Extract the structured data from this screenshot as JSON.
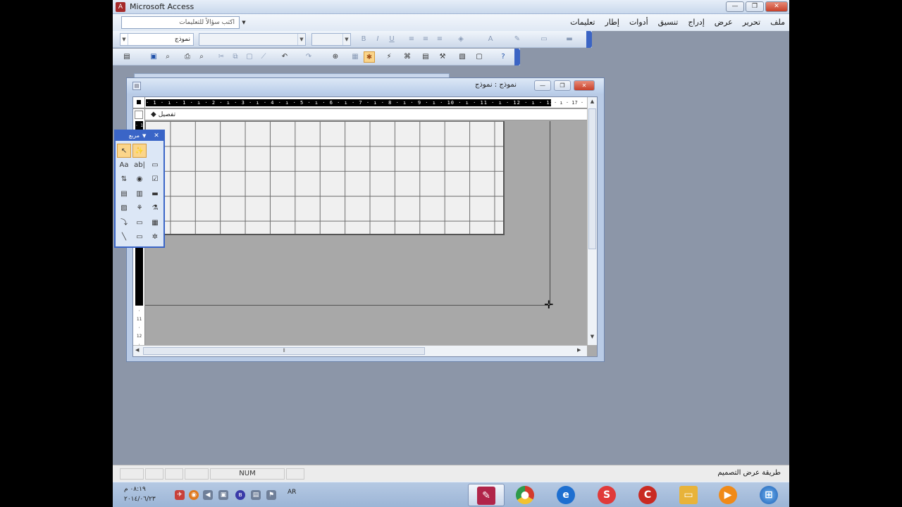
{
  "window": {
    "title": "Microsoft Access",
    "min": "—",
    "max": "❐",
    "close": "✕"
  },
  "menubar": {
    "ask_placeholder": "اكتب سؤالاً للتعليمات",
    "items": [
      "ملف",
      "تحرير",
      "عرض",
      "إدراج",
      "تنسيق",
      "أدوات",
      "إطار",
      "تعليمات"
    ]
  },
  "format_toolbar": {
    "object_combo": "نموذج",
    "font_combo": "",
    "size_combo": "",
    "bold": "B",
    "italic": "I",
    "underline": "U"
  },
  "form_window": {
    "caption": "نموذج : نموذج",
    "section_label": "تفصيل",
    "ruler_numbers": "· 1 · ı · 1 · ı · 2 · ı · 3 · ı · 4 · ı · 5 · ı · 6 · ı · 7 · ı · 8 · ı · 9 · ı · 10 · ı · 11 · ı · 12 · ı · 13 · ı · 14 · ı · 15 · ı · 16",
    "ruler_rest": "· ı · 17 · ı",
    "vruler_numbers": "· 1 · 2 · 3 · 4 · 5 · 6 · 7 · 8 · 9 · 10",
    "vruler_rest": "· 11 · 12 ·"
  },
  "toolbox": {
    "title": "مربع",
    "close": "✕"
  },
  "statusbar": {
    "num": "NUM",
    "message": "طريقة عرض التصميم"
  },
  "taskbar": {
    "time": "٠٨:١٩ م",
    "date": "٢٠١٤/٠٦/٢٣",
    "language": "AR",
    "apps": [
      {
        "name": "Microsoft Access",
        "color": "#b0254a",
        "active": true
      },
      {
        "name": "Google Chrome",
        "color": "#d33b2c",
        "active": false
      },
      {
        "name": "Internet Explorer",
        "color": "#1e6fd0",
        "active": false
      },
      {
        "name": "Snagit",
        "color": "#e03a3a",
        "active": false
      },
      {
        "name": "CCleaner",
        "color": "#c92a22",
        "active": false
      },
      {
        "name": "Windows Explorer",
        "color": "#e8b33a",
        "active": false
      },
      {
        "name": "Media Player",
        "color": "#f08a18",
        "active": false
      },
      {
        "name": "Start",
        "color": "#2a7ad0",
        "active": false
      }
    ]
  }
}
